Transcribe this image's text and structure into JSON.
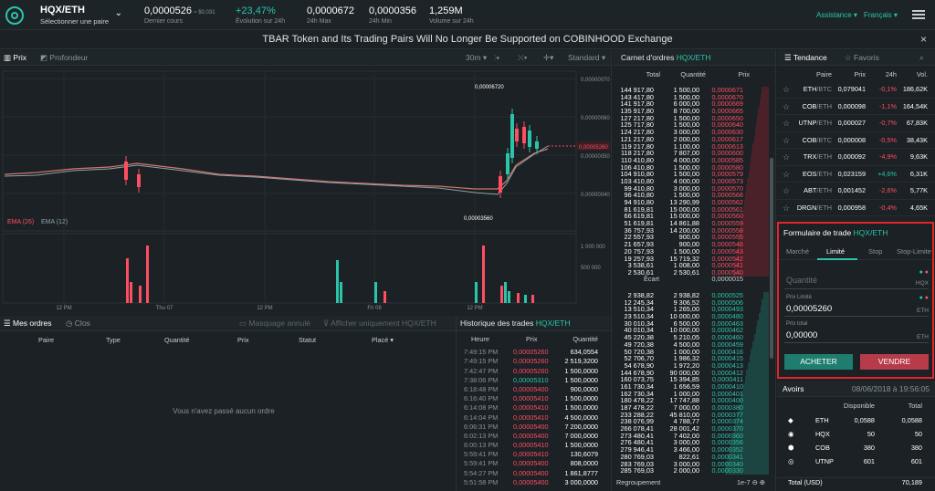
{
  "header": {
    "pair": "HQX/ETH",
    "pair_sub": "Sélectionner une paire",
    "last_price": "0,0000526",
    "last_price_usd": "≈ $0,031",
    "last_label": "Dernier cours",
    "change": "+23,47%",
    "change_label": "Évolution sur 24h",
    "high": "0,0000672",
    "high_label": "24h Max",
    "low": "0,0000356",
    "low_label": "24h Min",
    "volume": "1,259M",
    "volume_label": "Volume sur 24h",
    "assistance": "Assistance",
    "language": "Français"
  },
  "banner": "TBAR Token and Its Trading Pairs Will No Longer Be Supported on COBINHOOD Exchange",
  "chart": {
    "tab_price": "Prix",
    "tab_depth": "Profondeur",
    "interval": "30m",
    "style": "Standard",
    "high_label": "0,00006720",
    "low_label": "0,00003560",
    "current_label": "0,00005260",
    "ema1": "EMA (26)",
    "ema2": "EMA (12)",
    "y_ticks": [
      "0,00000070",
      "0,00000060",
      "0,00000050",
      "0,00000040"
    ],
    "vol_ticks": [
      "1 000 000",
      "500 000"
    ],
    "x_ticks": [
      "12 PM",
      "Thu 07",
      "12 PM",
      "Fri 08",
      "12 PM"
    ]
  },
  "chart_data": {
    "type": "bar",
    "title": "",
    "price_max": "0,00006720",
    "price_min": "0,00003560",
    "current": "0,00005260",
    "volume_axis": [
      "1 000 000",
      "500 000"
    ],
    "x_axis": [
      "12 PM",
      "Thu 07",
      "12 PM",
      "Fri 08",
      "12 PM"
    ]
  },
  "orders": {
    "tab_mine": "Mes ordres",
    "tab_closed": "Clos",
    "hide_cancel": "Masquage annulé",
    "show_only": "Afficher uniquement HQX/ETH",
    "columns": [
      "Paire",
      "Type",
      "Quantité",
      "Prix",
      "Statut",
      "Placé"
    ],
    "empty": "Vous n'avez passé aucun ordre"
  },
  "history": {
    "title": "Historique des trades",
    "pair": "HQX/ETH",
    "columns": [
      "Heure",
      "Prix",
      "Quantité"
    ],
    "rows": [
      [
        "7:49:15 PM",
        "0,00005260",
        "634,0554",
        "r"
      ],
      [
        "7:49:15 PM",
        "0,00005260",
        "2 519,3200",
        "r"
      ],
      [
        "7:42:47 PM",
        "0,00005260",
        "1 500,0000",
        "r"
      ],
      [
        "7:38:06 PM",
        "0,00005310",
        "1 500,0000",
        "g"
      ],
      [
        "6:18:48 PM",
        "0,00005400",
        "900,0000",
        "r"
      ],
      [
        "6:16:40 PM",
        "0,00005410",
        "1 500,0000",
        "r"
      ],
      [
        "6:14:08 PM",
        "0,00005410",
        "1 500,0000",
        "r"
      ],
      [
        "6:14:04 PM",
        "0,00005410",
        "4 500,0000",
        "r"
      ],
      [
        "6:06:31 PM",
        "0,00005400",
        "7 200,0000",
        "r"
      ],
      [
        "6:02:13 PM",
        "0,00005400",
        "7 000,0000",
        "r"
      ],
      [
        "6:00:13 PM",
        "0,00005410",
        "1 500,0000",
        "r"
      ],
      [
        "5:59:41 PM",
        "0,00005410",
        "130,6079",
        "r"
      ],
      [
        "5:59:41 PM",
        "0,00005400",
        "808,0000",
        "r"
      ],
      [
        "5:54:27 PM",
        "0,00005400",
        "1 861,8777",
        "r"
      ],
      [
        "5:51:58 PM",
        "0,00005400",
        "3 000,0000",
        "r"
      ]
    ]
  },
  "orderbook": {
    "title": "Carnet d'ordres",
    "pair": "HQX/ETH",
    "columns": [
      "Total",
      "Quantité",
      "Prix"
    ],
    "asks": [
      [
        "144 917,80",
        "1 500,00",
        "0,0000671"
      ],
      [
        "143 417,80",
        "1 500,00",
        "0,0000670"
      ],
      [
        "141 917,80",
        "6 000,00",
        "0,0000669"
      ],
      [
        "135 917,80",
        "8 700,00",
        "0,0000665"
      ],
      [
        "127 217,80",
        "1 500,00",
        "0,0000650"
      ],
      [
        "125 717,80",
        "1 500,00",
        "0,0000640"
      ],
      [
        "124 217,80",
        "3 000,00",
        "0,0000630"
      ],
      [
        "121 217,80",
        "2 000,00",
        "0,0000617"
      ],
      [
        "119 217,80",
        "1 100,00",
        "0,0000613"
      ],
      [
        "118 217,80",
        "7 807,00",
        "0,0000600"
      ],
      [
        "110 410,80",
        "4 000,00",
        "0,0000585"
      ],
      [
        "106 410,80",
        "1 500,00",
        "0,0000580"
      ],
      [
        "104 910,80",
        "1 500,00",
        "0,0000579"
      ],
      [
        "103 410,80",
        "4 000,00",
        "0,0000573"
      ],
      [
        "99 410,80",
        "3 000,00",
        "0,0000570"
      ],
      [
        "96 410,80",
        "1 500,00",
        "0,0000568"
      ],
      [
        "94 910,80",
        "13 290,99",
        "0,0000562"
      ],
      [
        "81 619,81",
        "15 000,00",
        "0,0000561"
      ],
      [
        "66 619,81",
        "15 000,00",
        "0,0000560"
      ],
      [
        "51 619,81",
        "14 861,88",
        "0,0000559"
      ],
      [
        "36 757,93",
        "14 200,00",
        "0,0000558"
      ],
      [
        "22 557,93",
        "900,00",
        "0,0000555"
      ],
      [
        "21 657,93",
        "900,00",
        "0,0000546"
      ],
      [
        "20 757,93",
        "1 500,00",
        "0,0000543"
      ],
      [
        "19 257,93",
        "15 719,32",
        "0,0000542"
      ],
      [
        "3 538,61",
        "1 008,00",
        "0,0000541"
      ],
      [
        "2 530,61",
        "2 530,61",
        "0,0000540"
      ]
    ],
    "spread_label": "Écart",
    "spread": "0,0000015",
    "bids": [
      [
        "2 938,82",
        "2 938,82",
        "0,0000525"
      ],
      [
        "12 245,34",
        "9 306,52",
        "0,0000506"
      ],
      [
        "13 510,34",
        "1 265,00",
        "0,0000493"
      ],
      [
        "23 510,34",
        "10 000,00",
        "0,0000480"
      ],
      [
        "30 010,34",
        "6 500,00",
        "0,0000463"
      ],
      [
        "40 010,34",
        "10 000,00",
        "0,0000462"
      ],
      [
        "45 220,38",
        "5 210,05",
        "0,0000460"
      ],
      [
        "49 720,38",
        "4 500,00",
        "0,0000459"
      ],
      [
        "50 720,38",
        "1 000,00",
        "0,0000416"
      ],
      [
        "52 706,70",
        "1 986,32",
        "0,0000415"
      ],
      [
        "54 678,90",
        "1 972,20",
        "0,0000413"
      ],
      [
        "144 678,90",
        "90 000,00",
        "0,0000412"
      ],
      [
        "160 073,75",
        "15 394,85",
        "0,0000411"
      ],
      [
        "161 730,34",
        "1 656,59",
        "0,0000410"
      ],
      [
        "162 730,34",
        "1 000,00",
        "0,0000401"
      ],
      [
        "180 478,22",
        "17 747,88",
        "0,0000400"
      ],
      [
        "187 478,22",
        "7 000,00",
        "0,0000380"
      ],
      [
        "233 288,22",
        "45 810,00",
        "0,0000377"
      ],
      [
        "238 076,99",
        "4 788,77",
        "0,0000374"
      ],
      [
        "266 078,41",
        "28 001,42",
        "0,0000370"
      ],
      [
        "273 480,41",
        "7 402,00",
        "0,0000360"
      ],
      [
        "276 480,41",
        "3 000,00",
        "0,0000356"
      ],
      [
        "279 946,41",
        "3 466,00",
        "0,0000352"
      ],
      [
        "280 769,03",
        "822,61",
        "0,0000341"
      ],
      [
        "283 769,03",
        "3 000,00",
        "0,0000340"
      ],
      [
        "285 769,03",
        "2 000,00",
        "0,0000330"
      ]
    ],
    "grouping": "Regroupement",
    "grouping_val": "1e-7"
  },
  "trend": {
    "tab": "Tendance",
    "tab_fav": "Favoris",
    "columns": [
      "Paire",
      "Prix",
      "24h",
      "Vol."
    ],
    "rows": [
      [
        "ETH",
        "/BTC",
        "0,079041",
        "-0,1%",
        "186,62K",
        "r"
      ],
      [
        "COB",
        "/ETH",
        "0,000098",
        "-1,1%",
        "164,54K",
        "r"
      ],
      [
        "UTNP",
        "/ETH",
        "0,000027",
        "-0,7%",
        "67,83K",
        "r"
      ],
      [
        "COB",
        "/BTC",
        "0,000008",
        "-0,5%",
        "38,43K",
        "r"
      ],
      [
        "TRX",
        "/ETH",
        "0,000092",
        "-4,9%",
        "9,63K",
        "r"
      ],
      [
        "EOS",
        "/ETH",
        "0,023159",
        "+4,6%",
        "6,31K",
        "g"
      ],
      [
        "ABT",
        "/ETH",
        "0,001452",
        "-2,6%",
        "5,77K",
        "r"
      ],
      [
        "DRGN",
        "/ETH",
        "0,000958",
        "-0,4%",
        "4,65K",
        "r"
      ]
    ]
  },
  "tradeform": {
    "title": "Formulaire de trade",
    "pair": "HQX/ETH",
    "tabs": [
      "Marché",
      "Limité",
      "Stop",
      "Stop-Limite"
    ],
    "qty_placeholder": "Quantité",
    "qty_unit": "HQX",
    "limit_label": "Prix Limité",
    "limit_value": "0,00005260",
    "limit_unit": "ETH",
    "total_label": "Prix total",
    "total_value": "0,00000",
    "total_unit": "ETH",
    "buy": "ACHETER",
    "sell": "VENDRE"
  },
  "assets": {
    "title": "Avoirs",
    "date": "08/06/2018 à 19:56:05",
    "columns": [
      "Disponible",
      "Total"
    ],
    "rows": [
      [
        "ETH",
        "0,0588",
        "0,0588"
      ],
      [
        "HQX",
        "50",
        "50"
      ],
      [
        "COB",
        "380",
        "380"
      ],
      [
        "UTNP",
        "601",
        "601"
      ]
    ],
    "total_label": "Total (USD)",
    "total_value": "70,189"
  },
  "colors": {
    "accent": "#2bc4a8",
    "red": "#ff4d61",
    "highlight": "#e2262a"
  }
}
